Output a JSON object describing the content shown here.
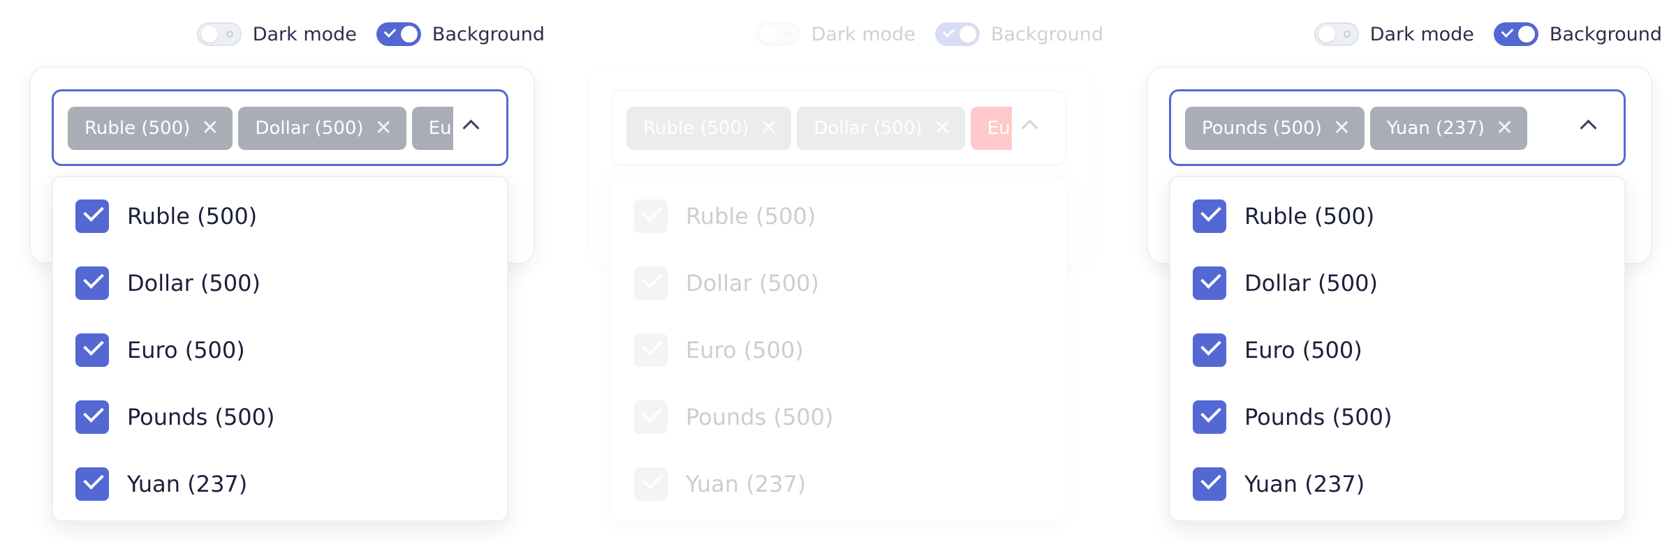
{
  "panels": [
    {
      "toggles": {
        "dark_mode": "Dark mode",
        "background": "Background"
      },
      "chips": [
        "Ruble (500)",
        "Dollar (500)",
        "Euro"
      ],
      "options": [
        "Ruble (500)",
        "Dollar (500)",
        "Euro (500)",
        "Pounds (500)",
        "Yuan (237)"
      ]
    },
    {
      "toggles": {
        "dark_mode": "Dark mode",
        "background": "Background"
      },
      "chips": [
        "Ruble (500)",
        "Dollar (500)",
        "Euro"
      ],
      "options": [
        "Ruble (500)",
        "Dollar (500)",
        "Euro (500)",
        "Pounds (500)",
        "Yuan (237)"
      ]
    },
    {
      "toggles": {
        "dark_mode": "Dark mode",
        "background": "Background"
      },
      "chips": [
        "Pounds (500)",
        "Yuan (237)"
      ],
      "options": [
        "Ruble (500)",
        "Dollar (500)",
        "Euro (500)",
        "Pounds (500)",
        "Yuan (237)"
      ]
    }
  ],
  "icons": {
    "chip_remove": "close-icon",
    "caret": "chevron-up-icon",
    "checkbox": "check-icon"
  },
  "colors": {
    "accent": "#5468d4",
    "chip": "#a9adb6",
    "alert_chip": "#ff0f0f"
  },
  "chip_remove_glyph": "✕"
}
